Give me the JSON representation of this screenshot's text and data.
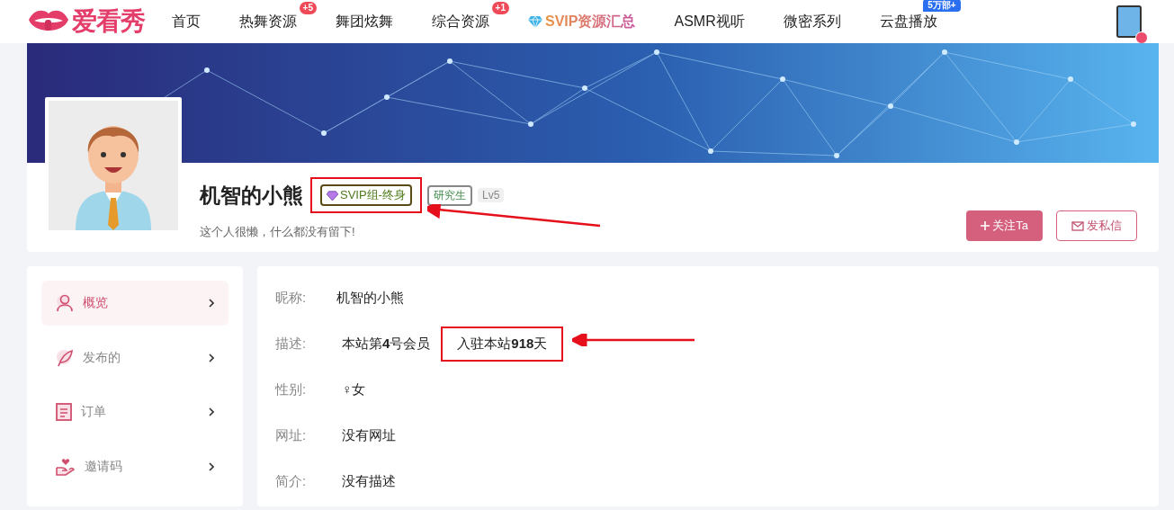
{
  "header": {
    "logo": "爱看秀",
    "nav": [
      {
        "label": "首页",
        "kind": "plain"
      },
      {
        "label": "热舞资源",
        "kind": "plain",
        "badge": {
          "text": "+5",
          "color": "#ef4a57"
        }
      },
      {
        "label": "舞团炫舞",
        "kind": "plain"
      },
      {
        "label": "综合资源",
        "kind": "plain",
        "badge": {
          "text": "+1",
          "color": "#ef4a57"
        }
      },
      {
        "label": "SVIP资源汇总",
        "kind": "vip"
      },
      {
        "label": "ASMR视听",
        "kind": "plain"
      },
      {
        "label": "微密系列",
        "kind": "plain"
      },
      {
        "label": "云盘播放",
        "kind": "plain",
        "badge": {
          "text": "5万部+",
          "color": "#2a6ff0"
        }
      }
    ]
  },
  "profile": {
    "name": "机智的小熊",
    "tags": [
      {
        "text": "SVIP组-终身",
        "kind": "vip",
        "highlighted": true
      },
      {
        "text": "研究生",
        "kind": "role",
        "highlighted": false
      },
      {
        "text": "Lv5",
        "kind": "level",
        "highlighted": false
      }
    ],
    "bio": "这个人很懒，什么都没有留下!",
    "buttons": [
      {
        "label": "关注Ta",
        "kind": "primary"
      },
      {
        "label": "发私信",
        "kind": "outline"
      }
    ]
  },
  "sidebar": {
    "items": [
      {
        "label": "概览",
        "selected": true
      },
      {
        "label": "发布的",
        "selected": false
      },
      {
        "label": "订单",
        "selected": false
      },
      {
        "label": "邀请码",
        "selected": false
      }
    ]
  },
  "details": [
    {
      "label": "昵称:",
      "values": [
        {
          "text": "机智的小熊",
          "highlighted": false
        }
      ]
    },
    {
      "label": "描述:",
      "values": [
        {
          "text": "本站第**4**号会员",
          "highlighted": false
        },
        {
          "text": "入驻本站**918**天",
          "highlighted": true
        }
      ]
    },
    {
      "label": "性别:",
      "values": [
        {
          "text": "♀女",
          "highlighted": false
        }
      ]
    },
    {
      "label": "网址:",
      "values": [
        {
          "text": "没有网址",
          "highlighted": false
        }
      ]
    },
    {
      "label": "简介:",
      "values": [
        {
          "text": "没有描述",
          "highlighted": false
        }
      ]
    }
  ]
}
